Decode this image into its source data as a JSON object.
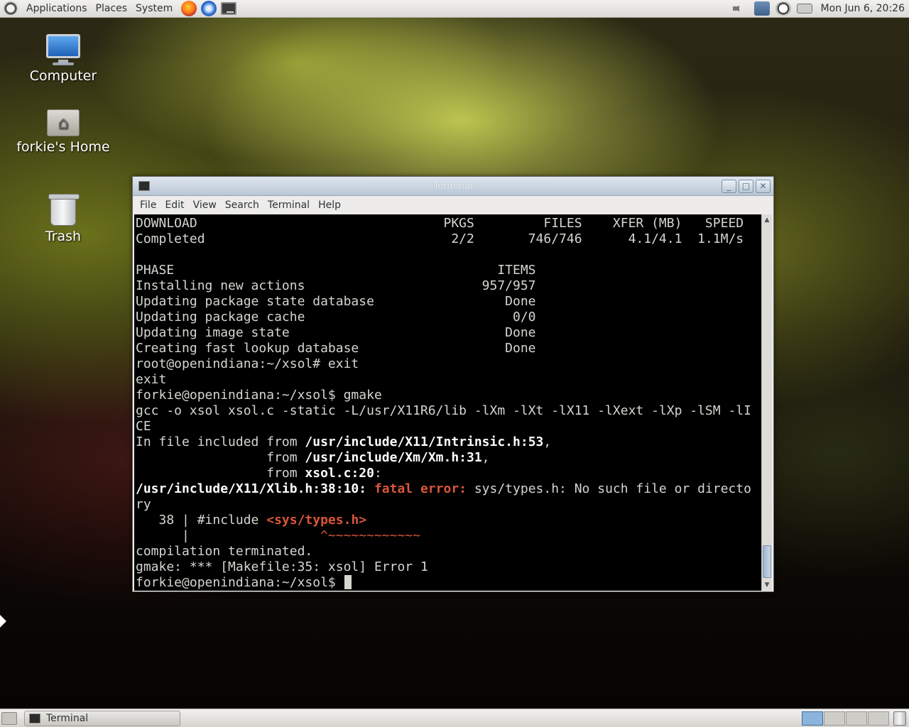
{
  "top_panel": {
    "menus": [
      "Applications",
      "Places",
      "System"
    ],
    "clock": "Mon Jun  6, 20:26"
  },
  "desktop": {
    "icons": [
      {
        "label": "Computer"
      },
      {
        "label": "forkie's Home"
      },
      {
        "label": "Trash"
      }
    ]
  },
  "window": {
    "title": "Terminal",
    "menus": [
      "File",
      "Edit",
      "View",
      "Search",
      "Terminal",
      "Help"
    ]
  },
  "terminal": {
    "lines": [
      "DOWNLOAD                                PKGS         FILES    XFER (MB)   SPEED",
      "Completed                                2/2       746/746      4.1/4.1  1.1M/s",
      "",
      "PHASE                                          ITEMS",
      "Installing new actions                       957/957",
      "Updating package state database                 Done",
      "Updating package cache                           0/0",
      "Updating image state                            Done",
      "Creating fast lookup database                   Done",
      "root@openindiana:~/xsol# exit",
      "exit",
      "forkie@openindiana:~/xsol$ gmake",
      "gcc -o xsol xsol.c -static -L/usr/X11R6/lib -lXm -lXt -lX11 -lXext -lXp -lSM -lI",
      "CE"
    ],
    "include_line": {
      "prefix": "In file included from ",
      "path": "/usr/include/X11/Intrinsic.h:53",
      "suffix": ","
    },
    "from_line_1": {
      "prefix": "                 from ",
      "path": "/usr/include/Xm/Xm.h:31",
      "suffix": ","
    },
    "from_line_2": {
      "prefix": "                 from ",
      "path": "xsol.c:20",
      "suffix": ":"
    },
    "error_line": {
      "location": "/usr/include/X11/Xlib.h:38:10:",
      "kind": "fatal error:",
      "message": " sys/types.h: No such file or directo"
    },
    "error_wrap": "ry",
    "source_line": {
      "prefix": "   38 | #include ",
      "highlight": "<sys/types.h>"
    },
    "caret_line": {
      "prefix": "      | ",
      "highlight": "                ^~~~~~~~~~~~~"
    },
    "tail_lines": [
      "compilation terminated.",
      "gmake: *** [Makefile:35: xsol] Error 1"
    ],
    "prompt": "forkie@openindiana:~/xsol$ "
  }
}
